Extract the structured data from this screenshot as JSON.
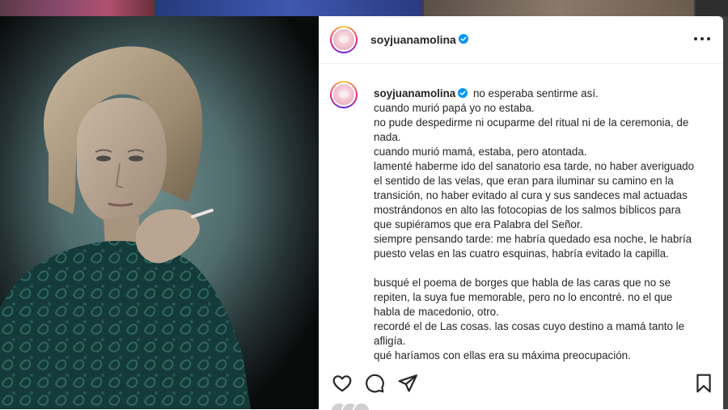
{
  "colors": {
    "accent_blue": "#0095f6",
    "text": "#262626",
    "backdrop": "#3f3f3f"
  },
  "post": {
    "username": "soyjuanamolina",
    "verified": true
  },
  "caption": {
    "first_line": "no esperaba sentirme así.",
    "lines": [
      "cuando murió papá yo no estaba.",
      "no pude despedirme ni ocuparme del ritual ni de la ceremonia, de",
      "nada.",
      "cuando murió mamá, estaba, pero atontada.",
      "lamenté haberme ido del sanatorio esa tarde, no haber averiguado",
      "el sentido de las velas, que eran para iluminar su camino en la",
      "transición, no haber evitado al cura y sus sandeces mal actuadas",
      "mostrándonos en alto las fotocopias de los salmos bíblicos para",
      "que supiéramos que era Palabra del Señor.",
      "siempre pensando tarde: me habría quedado esa noche, le habría",
      "puesto velas en las cuatro esquinas, habría evitado la capilla.",
      "",
      "busqué el poema de borges que habla de las caras que no se",
      "repiten, la suya fue memorable, pero no lo encontré. no el que",
      "habla de macedonio, otro.",
      "recordé el de Las cosas. las cosas cuyo destino a mamá tanto le",
      "afligía.",
      "qué haríamos con ellas era su máxima preocupación."
    ]
  },
  "icons": {
    "more": "more-options-icon",
    "like": "heart-icon",
    "comment": "comment-icon",
    "share": "share-icon",
    "save": "bookmark-icon",
    "verified": "verified-badge-icon"
  }
}
